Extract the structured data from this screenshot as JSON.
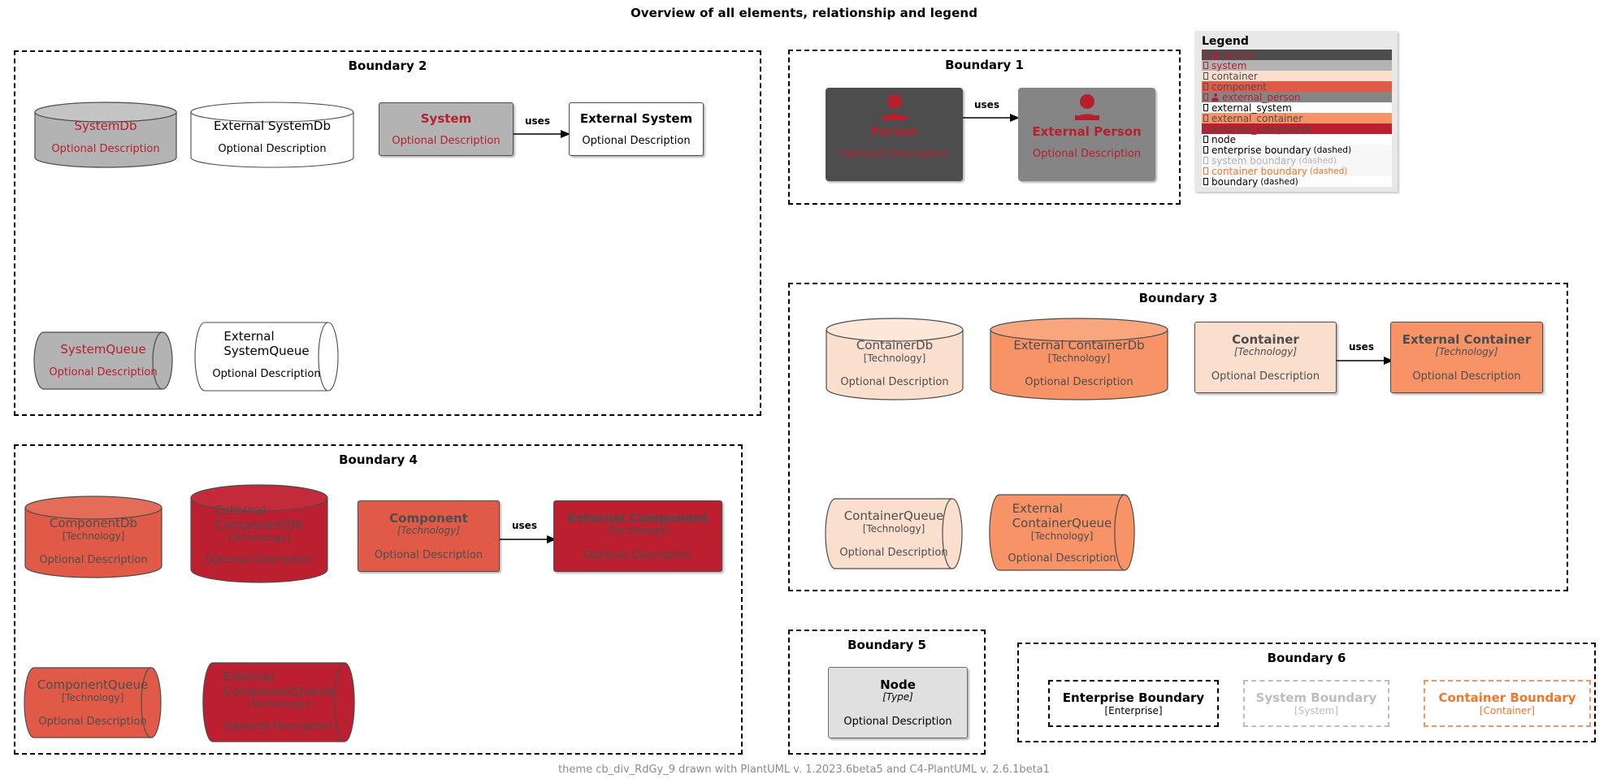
{
  "title": "Overview of all elements, relationship and legend",
  "footer": "theme cb_div_RdGy_9 drawn with PlantUML v. 1.2023.6beta5 and C4-PlantUML v. 2.6.1beta1",
  "labels": {
    "optional_description": "Optional Description",
    "technology": "[Technology]",
    "type": "[Type]",
    "uses": "uses",
    "enterprise_tag": "[Enterprise]",
    "system_tag": "[System]",
    "container_tag": "[Container]"
  },
  "boundaries": {
    "b1": {
      "title": "Boundary 1"
    },
    "b2": {
      "title": "Boundary 2"
    },
    "b3": {
      "title": "Boundary 3"
    },
    "b4": {
      "title": "Boundary 4"
    },
    "b5": {
      "title": "Boundary 5"
    },
    "b6": {
      "title": "Boundary 6"
    }
  },
  "elements": {
    "person": {
      "name": "Person",
      "description": "Optional Description"
    },
    "external_person": {
      "name": "External Person",
      "description": "Optional Description"
    },
    "system_db": {
      "name": "SystemDb",
      "description": "Optional Description"
    },
    "external_system_db": {
      "name": "External SystemDb",
      "description": "Optional Description"
    },
    "system": {
      "name": "System",
      "description": "Optional Description"
    },
    "external_system": {
      "name": "External System",
      "description": "Optional Description"
    },
    "system_queue": {
      "name": "SystemQueue",
      "description": "Optional Description"
    },
    "external_system_queue": {
      "name": "External\nSystemQueue",
      "description": "Optional Description"
    },
    "container_db": {
      "name": "ContainerDb",
      "technology": "[Technology]",
      "description": "Optional Description"
    },
    "external_container_db": {
      "name": "External ContainerDb",
      "technology": "[Technology]",
      "description": "Optional Description"
    },
    "container": {
      "name": "Container",
      "technology": "[Technology]",
      "description": "Optional Description"
    },
    "external_container": {
      "name": "External Container",
      "technology": "[Technology]",
      "description": "Optional Description"
    },
    "container_queue": {
      "name": "ContainerQueue",
      "technology": "[Technology]",
      "description": "Optional Description"
    },
    "external_container_queue": {
      "name": "External\nContainerQueue",
      "technology": "[Technology]",
      "description": "Optional Description"
    },
    "component_db": {
      "name": "ComponentDb",
      "technology": "[Technology]",
      "description": "Optional Description"
    },
    "external_component_db": {
      "name": "External\nComponentDb",
      "technology": "[Technology]",
      "description": "Optional Description"
    },
    "component": {
      "name": "Component",
      "technology": "[Technology]",
      "description": "Optional Description"
    },
    "external_component": {
      "name": "External Component",
      "technology": "[Technology]",
      "description": "Optional Description"
    },
    "component_queue": {
      "name": "ComponentQueue",
      "technology": "[Technology]",
      "description": "Optional Description"
    },
    "external_component_queue": {
      "name": "External\nComponentQueue",
      "technology": "[Technology]",
      "description": "Optional Description"
    },
    "node": {
      "name": "Node",
      "technology": "[Type]",
      "description": "Optional Description"
    },
    "enterprise_boundary": {
      "name": "Enterprise Boundary",
      "technology": "[Enterprise]"
    },
    "system_boundary": {
      "name": "System Boundary",
      "technology": "[System]"
    },
    "container_boundary": {
      "name": "Container Boundary",
      "technology": "[Container]"
    }
  },
  "relations": [
    {
      "id": "rel_person",
      "label": "uses"
    },
    {
      "id": "rel_system",
      "label": "uses"
    },
    {
      "id": "rel_container",
      "label": "uses"
    },
    {
      "id": "rel_component",
      "label": "uses"
    }
  ],
  "legend": {
    "title": "Legend",
    "rows": [
      {
        "key": "person",
        "label": "person",
        "sub": "",
        "bg": "#4d4d4d",
        "fg": "#b5202f",
        "icon": "person-icon"
      },
      {
        "key": "system",
        "label": "system",
        "sub": "",
        "bg": "#b3b3b3",
        "fg": "#b5202f",
        "icon": "tofu-icon"
      },
      {
        "key": "container",
        "label": "container",
        "sub": "",
        "bg": "#fbdfce",
        "fg": "#4d4d4d",
        "icon": "tofu-icon"
      },
      {
        "key": "component",
        "label": "component",
        "sub": "",
        "bg": "#e05a47",
        "fg": "#4d4d4d",
        "icon": "tofu-icon"
      },
      {
        "key": "external_person",
        "label": "external_person",
        "sub": "",
        "bg": "#858585",
        "fg": "#b5202f",
        "icon": "person-icon"
      },
      {
        "key": "external_system",
        "label": "external_system",
        "sub": "",
        "bg": "#ffffff",
        "fg": "#000000",
        "icon": "tofu-icon"
      },
      {
        "key": "external_container",
        "label": "external_container",
        "sub": "",
        "bg": "#f79366",
        "fg": "#4d4d4d",
        "icon": "tofu-icon"
      },
      {
        "key": "external_component",
        "label": "external_component",
        "sub": "",
        "bg": "#bc1f2f",
        "fg": "#4d4d4d",
        "icon": "tofu-icon"
      },
      {
        "key": "node",
        "label": "node",
        "sub": "",
        "bg": "#ffffff",
        "fg": "#000000",
        "icon": "tofu-icon"
      },
      {
        "key": "enterprise_boundary",
        "label": "enterprise boundary",
        "sub": "(dashed)",
        "bg": "#f7f7f7",
        "fg": "#000000",
        "icon": "tofu-icon"
      },
      {
        "key": "system_boundary",
        "label": "system boundary",
        "sub": "(dashed)",
        "bg": "#f7f7f7",
        "fg": "#b3b3b3",
        "icon": "tofu-icon"
      },
      {
        "key": "container_boundary",
        "label": "container boundary",
        "sub": "(dashed)",
        "bg": "#f7f7f7",
        "fg": "#f4762a",
        "icon": "tofu-icon"
      },
      {
        "key": "boundary",
        "label": "boundary",
        "sub": "(dashed)",
        "bg": "#ffffff",
        "fg": "#000000",
        "icon": "tofu-icon"
      }
    ]
  },
  "colors": {
    "person_bg": "#4d4d4d",
    "external_person_bg": "#858585",
    "system_bg": "#b3b3b3",
    "external_system_bg": "#ffffff",
    "container_bg": "#fbdfce",
    "external_container_bg": "#f79366",
    "component_bg": "#e05a47",
    "external_component_bg": "#bc1f2f",
    "node_bg": "#e0e0e0",
    "red_text": "#b5202f",
    "dark_text": "#4d4d4d",
    "orange_boundary": "#f4762a",
    "grey_boundary": "#bdbdbd"
  }
}
